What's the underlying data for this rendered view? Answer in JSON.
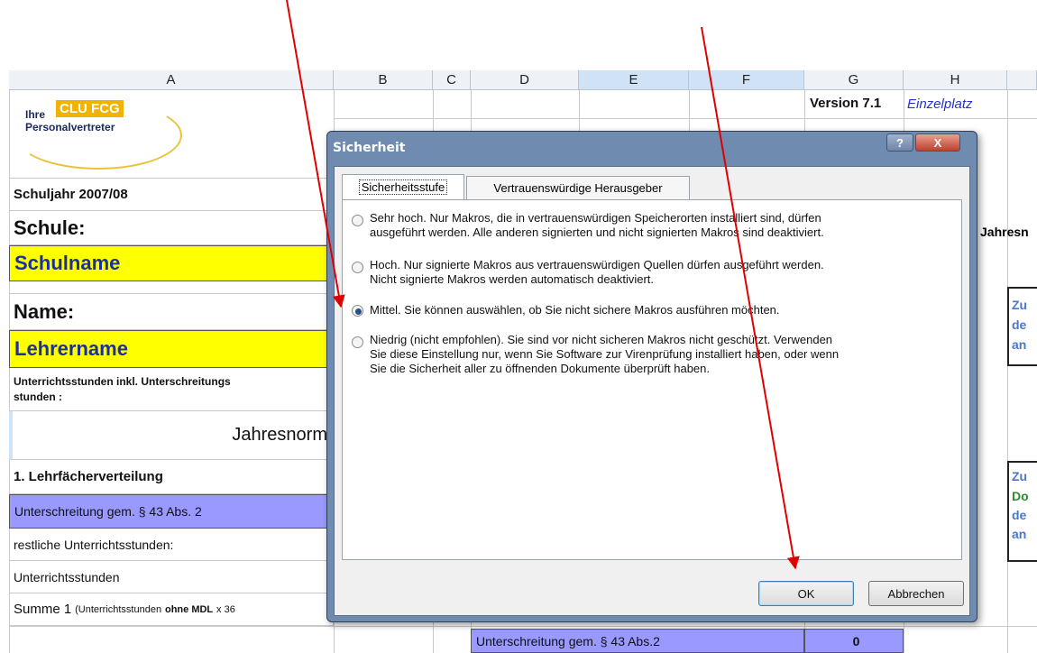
{
  "columns": [
    "A",
    "B",
    "C",
    "D",
    "E",
    "F",
    "G",
    "H"
  ],
  "header_right": {
    "version": "Version 7.1",
    "edition": "Einzelplatz"
  },
  "logo": {
    "ihre": "Ihre",
    "brand": "CLU FCG",
    "text": "Personalvertreter"
  },
  "rows": {
    "schuljahr": "Schuljahr 2007/08",
    "schule": "Schule:",
    "schulname": "Schulname",
    "name": "Name:",
    "lehrername": "Lehrername",
    "unterricht_l1": "Unterrichtsstunden inkl. Unterschreitungs",
    "unterricht_l2": "stunden :",
    "jahresnorm": "Jahresnorm",
    "lehrfaecher": "1. Lehrfächerverteilung",
    "unterschreitung": "Unterschreitung gem. § 43 Abs. 2",
    "restliche": "restliche Unterrichtsstunden:",
    "unterrichtsstunden": "Unterrichtsstunden",
    "summe_a": "Summe 1",
    "summe_b": "(Unterrichtsstunden",
    "summe_c": "ohne MDL",
    "summe_d": "x 36",
    "bottom_label": "Unterschreitung gem. § 43 Abs.2",
    "bottom_value": "0"
  },
  "right_edge": {
    "jahres": "Jahresn",
    "zu1": "Zu",
    "de1": "de",
    "an1": "an",
    "zu2": "Zu",
    "do2": "Do",
    "de2": "de",
    "an2": "an"
  },
  "dialog": {
    "title": "Sicherheit",
    "help": "?",
    "close": "X",
    "tabs": [
      "Sicherheitsstufe",
      "Vertrauenswürdige Herausgeber"
    ],
    "options": [
      {
        "line1": "Sehr hoch. Nur Makros, die in vertrauenswürdigen Speicherorten installiert sind, dürfen",
        "line2": "ausgeführt werden. Alle anderen signierten und nicht signierten Makros sind deaktiviert.",
        "selected": false
      },
      {
        "line1": "Hoch. Nur signierte Makros aus vertrauenswürdigen Quellen dürfen ausgeführt werden.",
        "line2": "Nicht signierte Makros werden automatisch deaktiviert.",
        "selected": false
      },
      {
        "line1": "Mittel. Sie können auswählen, ob Sie nicht sichere Makros ausführen möchten.",
        "selected": true
      },
      {
        "line1": "Niedrig (nicht empfohlen). Sie sind vor nicht sicheren Makros nicht geschützt. Verwenden",
        "line2": "Sie diese Einstellung nur, wenn Sie Software zur Virenprüfung installiert haben, oder wenn",
        "line3": "Sie die Sicherheit aller zu öffnenden Dokumente überprüft haben.",
        "selected": false
      }
    ],
    "ok": "OK",
    "cancel": "Abbrechen"
  },
  "colors": {
    "arrow": "#e00000",
    "dialog_frame": "#6f8bb0",
    "yellow": "#ffff00",
    "purple": "#9999ff"
  }
}
